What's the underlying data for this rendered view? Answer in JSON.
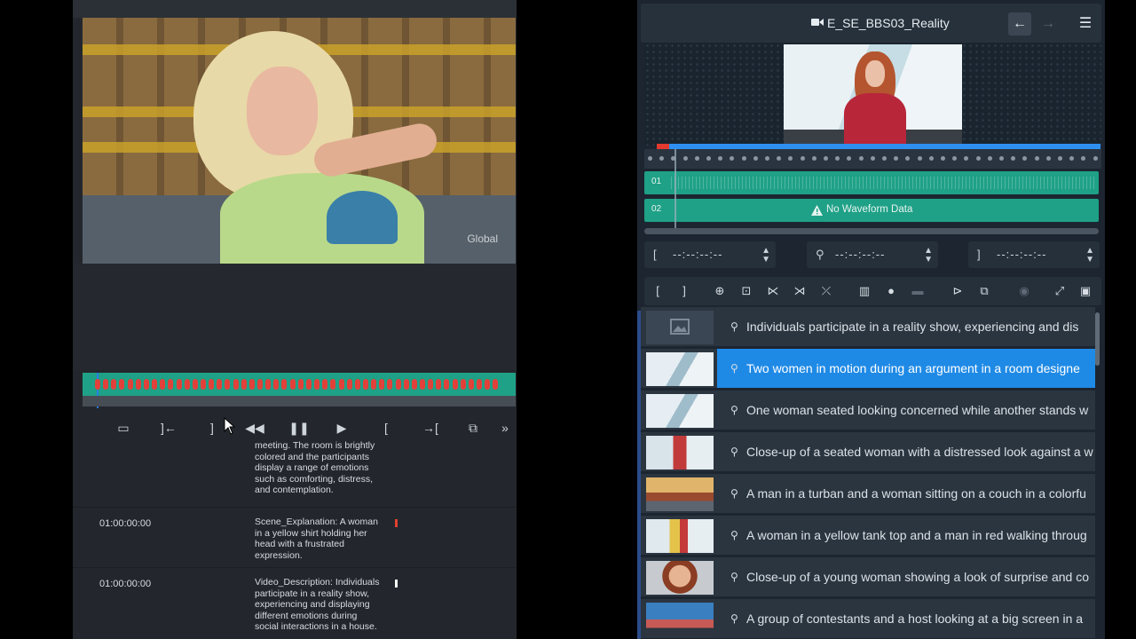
{
  "left": {
    "watermark": "Global",
    "toolbar": [
      "▭",
      "]←",
      "]",
      "◀◀",
      "❚❚",
      "▶",
      "[",
      "→[",
      "⧉",
      "»"
    ],
    "rows": [
      {
        "timecode": "",
        "text": "meeting. The room is brightly colored and the participants display a range of emotions such as comforting, distress, and contemplation.",
        "flag": ""
      },
      {
        "timecode": "01:00:00:00",
        "text": "Scene_Explanation: A woman in a yellow shirt holding her head with a frustrated expression.",
        "flag": "#e2402f"
      },
      {
        "timecode": "01:00:00:00",
        "text": "Video_Description: Individuals participate in a reality show, experiencing and displaying different emotions during social interactions in a house.",
        "flag": "#ffffff"
      }
    ]
  },
  "right": {
    "title": "E_SE_BBS03_Reality",
    "nav": {
      "back": "←",
      "forward": "→",
      "menu": "☰"
    },
    "tracks": {
      "t1": "01",
      "t2": "02",
      "no_waveform": "No Waveform Data"
    },
    "timecodes": {
      "in": {
        "bracket": "[",
        "value": "--:--:--:--"
      },
      "marker": {
        "bracket": "⚲",
        "value": "--:--:--:--"
      },
      "out": {
        "bracket": "]",
        "value": "--:--:--:--"
      }
    },
    "list": [
      {
        "text": "Individuals participate in a reality show, experiencing and dis",
        "thumb": "placeholder",
        "selected": false
      },
      {
        "text": "Two women in motion during an argument in a room designe",
        "thumb": "room",
        "selected": true
      },
      {
        "text": "One woman seated looking concerned while another stands w",
        "thumb": "room",
        "selected": false
      },
      {
        "text": "Close-up of a seated woman with a distressed look against a w",
        "thumb": "closeup",
        "selected": false
      },
      {
        "text": "A man in a turban and a woman sitting on a couch in a colorfu",
        "thumb": "couch",
        "selected": false
      },
      {
        "text": "A woman in a yellow tank top and a man in red walking throug",
        "thumb": "walk",
        "selected": false
      },
      {
        "text": "Close-up of a young woman showing a look of surprise and co",
        "thumb": "face",
        "selected": false
      },
      {
        "text": "A group of contestants and a host looking at a big screen in a",
        "thumb": "group",
        "selected": false
      }
    ]
  },
  "colors": {
    "accent": "#1f8ae6",
    "track": "#1fa187",
    "marker": "#e2403a"
  }
}
